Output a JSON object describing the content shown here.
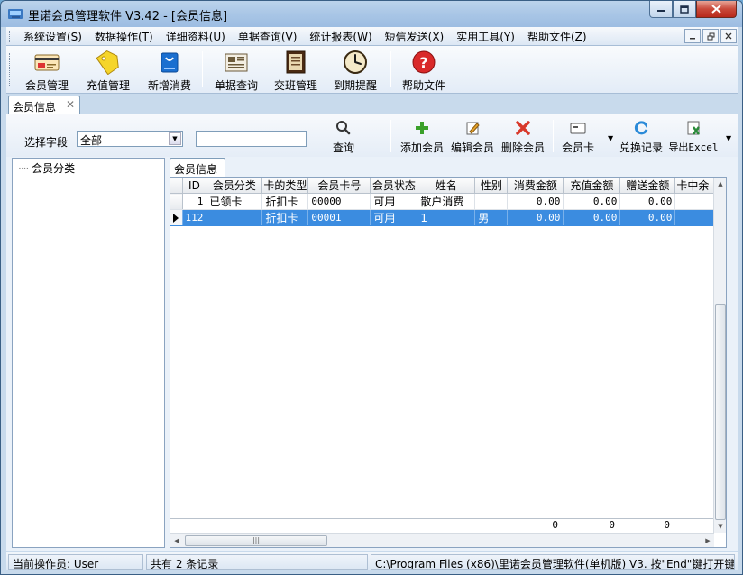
{
  "window": {
    "title": "里诺会员管理软件 V3.42 - [会员信息]"
  },
  "menu": {
    "items": [
      "系统设置(S)",
      "数据操作(T)",
      "详细资料(U)",
      "单据查询(V)",
      "统计报表(W)",
      "短信发送(X)",
      "实用工具(Y)",
      "帮助文件(Z)"
    ]
  },
  "toolbar": {
    "member_mgmt": "会员管理",
    "recharge_mgmt": "充值管理",
    "new_consume": "新增消费",
    "bill_query": "单据查询",
    "shift_mgmt": "交班管理",
    "expiry_remind": "到期提醒",
    "help_file": "帮助文件"
  },
  "doc_tab": {
    "label": "会员信息"
  },
  "filter": {
    "field_label": "选择字段",
    "field_value": "全部",
    "search_text": "",
    "query_label": "查询",
    "add_member": "添加会员",
    "edit_member": "编辑会员",
    "delete_member": "删除会员",
    "member_card": "会员卡",
    "exchange_record": "兑换记录",
    "export_excel": "导出Excel"
  },
  "tree": {
    "root_label": "会员分类"
  },
  "grid_tab": {
    "label": "会员信息"
  },
  "grid": {
    "columns": [
      "ID",
      "会员分类",
      "卡的类型",
      "会员卡号",
      "会员状态",
      "姓名",
      "性别",
      "消费金额",
      "充值金额",
      "赠送金额",
      "卡中余"
    ],
    "rows": [
      {
        "id": "1",
        "category": "已领卡",
        "card_type": "折扣卡",
        "card_no": "00000",
        "status": "可用",
        "name": "散户消费",
        "gender": "",
        "consume": "0.00",
        "recharge": "0.00",
        "bonus": "0.00",
        "balance": ""
      },
      {
        "id": "112",
        "category": "",
        "card_type": "折扣卡",
        "card_no": "00001",
        "status": "可用",
        "name": "1",
        "gender": "男",
        "consume": "0.00",
        "recharge": "0.00",
        "bonus": "0.00",
        "balance": ""
      }
    ],
    "totals": {
      "consume": "0",
      "recharge": "0",
      "bonus": "0"
    }
  },
  "status": {
    "operator": "当前操作员: User",
    "record_count": "共有 2 条记录",
    "path_hint": "C:\\Program Files (x86)\\里诺会员管理软件(单机版) V3. 按\"End\"键打开键"
  },
  "colors": {
    "selection": "#3b8ce0",
    "titlebar": "#a9c6e6",
    "close_button": "#c9493a"
  }
}
